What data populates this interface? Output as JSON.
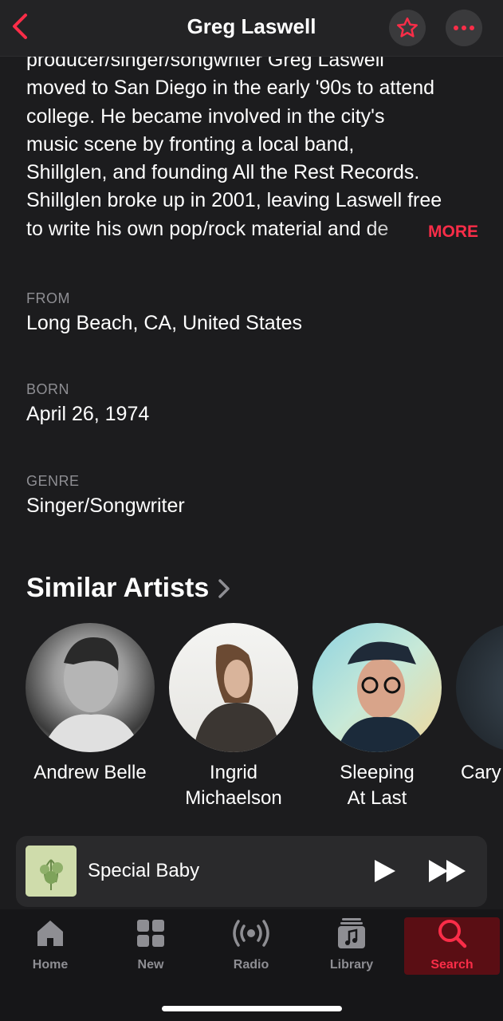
{
  "header": {
    "title": "Greg Laswell"
  },
  "bio": {
    "lines": [
      "producer/singer/songwriter Greg Laswell",
      "moved to San Diego in the early '90s to attend",
      "college. He became involved in the city's",
      "music scene by fronting a local band,",
      "Shillglen, and founding All the Rest Records.",
      "Shillglen broke up in 2001, leaving Laswell free",
      "to write his own pop/rock material and de"
    ],
    "more_label": "MORE"
  },
  "info": {
    "from_label": "FROM",
    "from_value": "Long Beach, CA, United States",
    "born_label": "BORN",
    "born_value": "April 26, 1974",
    "genre_label": "GENRE",
    "genre_value": "Singer/Songwriter"
  },
  "similar": {
    "title": "Similar Artists",
    "artists": [
      {
        "line1": "Andrew Belle",
        "line2": ""
      },
      {
        "line1": "Ingrid",
        "line2": "Michaelson"
      },
      {
        "line1": "Sleeping",
        "line2": "At Last"
      },
      {
        "line1": "Cary",
        "line2": ""
      }
    ]
  },
  "now_playing": {
    "title": "Special Baby"
  },
  "tabs": [
    {
      "label": "Home",
      "icon": "home-icon"
    },
    {
      "label": "New",
      "icon": "grid-icon"
    },
    {
      "label": "Radio",
      "icon": "radio-icon"
    },
    {
      "label": "Library",
      "icon": "library-icon"
    },
    {
      "label": "Search",
      "icon": "search-icon",
      "active": true
    }
  ],
  "colors": {
    "accent": "#fa2d48",
    "background": "#1c1c1e",
    "secondary_text": "#8e8e93"
  }
}
